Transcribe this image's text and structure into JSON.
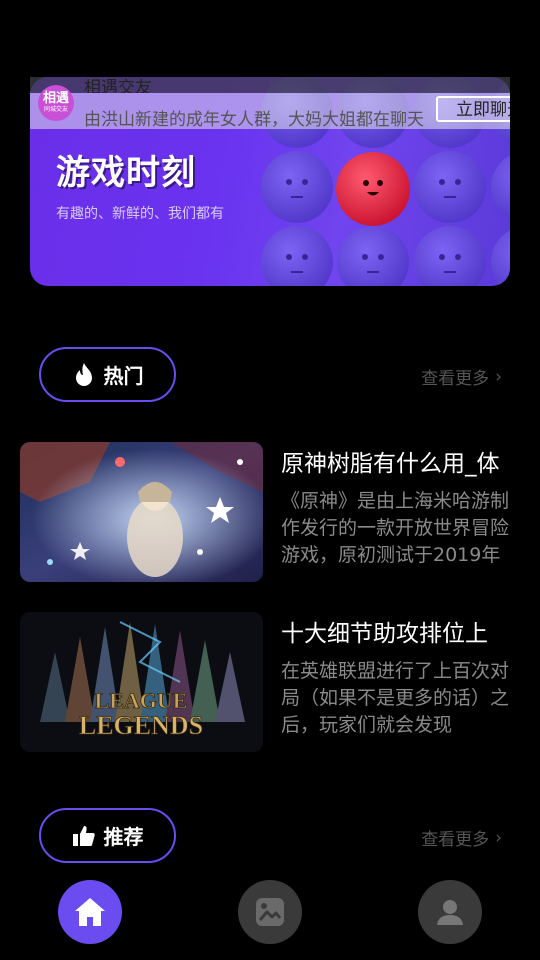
{
  "banner": {
    "title": "游戏时刻",
    "subtitle": "有趣的、新鲜的、我们都有",
    "ad": {
      "logo_text": "相遇",
      "logo_subtext": "同城交友",
      "name": "相遇交友",
      "description": "由洪山新建的成年女人群，大妈大姐都在聊天",
      "cta": "立即聊天"
    }
  },
  "hot": {
    "label": "热门",
    "more": "查看更多",
    "items": [
      {
        "title": "原神树脂有什么用_体",
        "description": "《原神》是由上海米哈游制作发行的一款开放世界冒险游戏，原初测试于2019年"
      },
      {
        "title": "十大细节助攻排位上",
        "description": "在英雄联盟进行了上百次对局（如果不是更多的话）之后，玩家们就会发现"
      }
    ]
  },
  "recommend": {
    "label": "推荐",
    "more": "查看更多"
  },
  "thumb2_text": {
    "line1": "LEAGUE",
    "line2": "LEGENDS"
  },
  "nav": {
    "items": [
      {
        "icon": "home-icon",
        "active": true
      },
      {
        "icon": "gallery-icon",
        "active": false
      },
      {
        "icon": "profile-icon",
        "active": false
      }
    ]
  },
  "colors": {
    "accent": "#6b4cf0",
    "background": "#000000",
    "muted_text": "#8a8a8a",
    "nav_inactive": "#3a3a3a"
  }
}
